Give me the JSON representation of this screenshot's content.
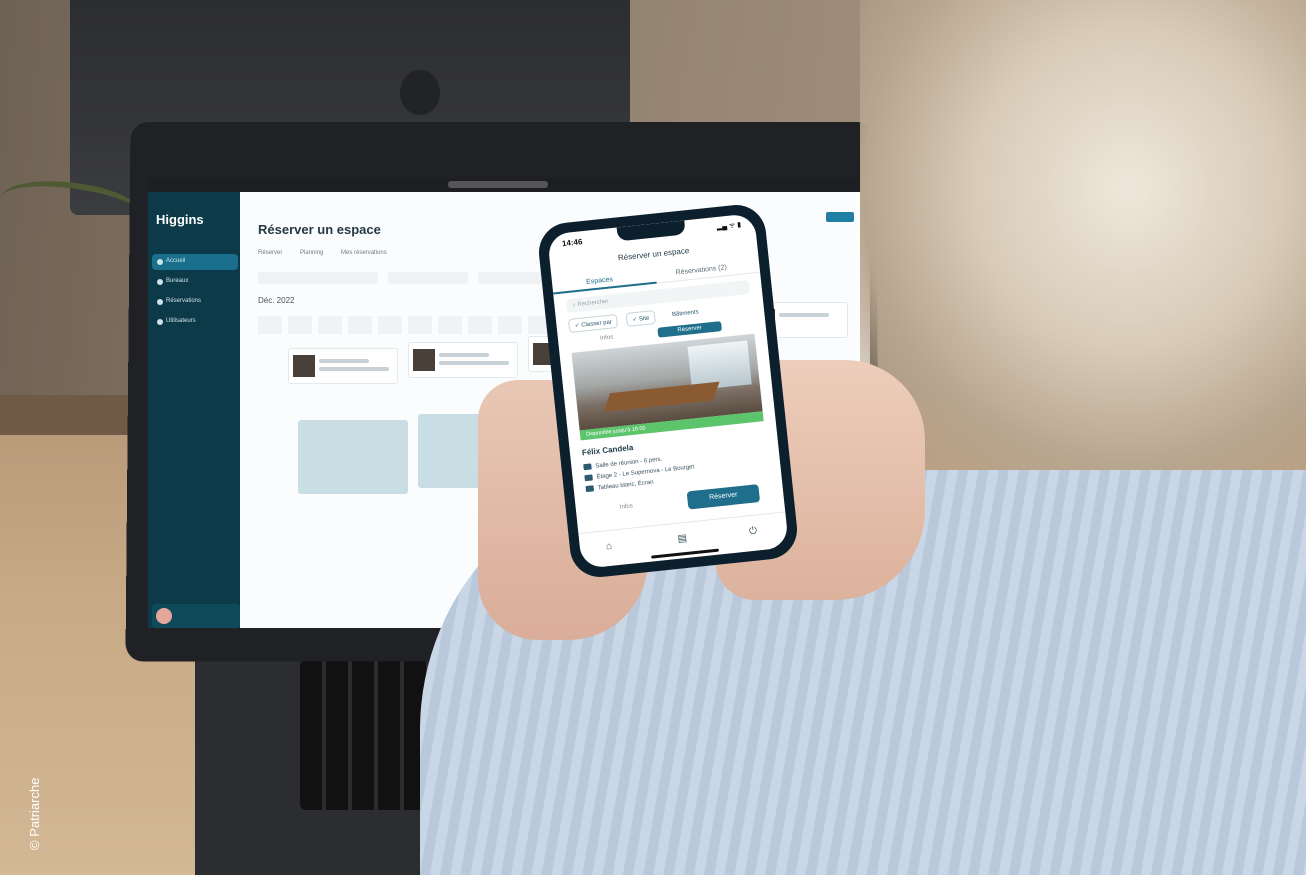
{
  "credit": "© Patriarche",
  "laptop": {
    "app_logo": "Higgins",
    "page_title": "Réserver un espace",
    "tabs": [
      "Réserver",
      "Planning",
      "Mes réservations"
    ],
    "calendar_month": "Déc. 2022",
    "nav_items": [
      "Accueil",
      "Bureaux",
      "Réservations",
      "Utilisateurs"
    ]
  },
  "phone": {
    "status_time": "14:46",
    "status_icons": "▂▄ ᯤ ▮",
    "title": "Réserver un espace",
    "tabs": {
      "spaces": "Espaces",
      "reservations": "Réservations (2)"
    },
    "search_placeholder": "Rechercher",
    "chips": [
      "✓ Classer par",
      "✓ Site",
      "Bâtiments"
    ],
    "mini_row": {
      "infos": "Infos",
      "button": "Réserver"
    },
    "availability": "Disponible jusqu'à 18:00",
    "room": {
      "name": "Félix Candela",
      "type": "Salle de réunion - 6 pers.",
      "location": "Étage 2 - Le Supernova - Le Bourget",
      "equipment": "Tableau blanc, Écran"
    },
    "infos_label": "Infos",
    "reserve_button": "Réserver",
    "nav_icons": [
      "home-icon",
      "calendar-icon",
      "power-icon"
    ]
  },
  "colors": {
    "sidebar": "#0c3a48",
    "accent": "#1f6e8c",
    "available": "#5cc46a"
  }
}
